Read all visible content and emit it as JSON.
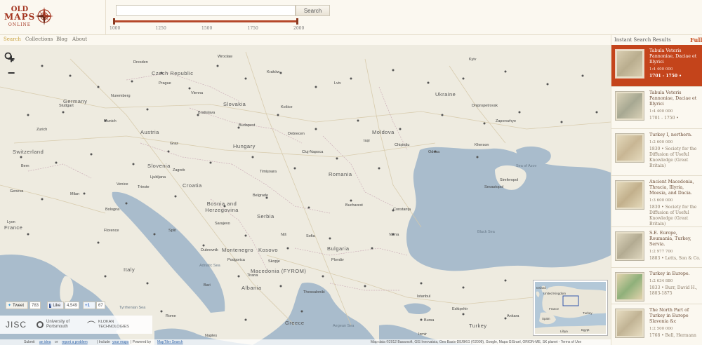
{
  "header": {
    "logo": {
      "line1": "OLD",
      "line2": "MAPS",
      "line3": "ONLINE"
    },
    "search": {
      "placeholder": "",
      "button_label": "Search"
    },
    "timeline": {
      "ticks": [
        "1000",
        "1250",
        "1500",
        "1750",
        "2000"
      ],
      "range_start": 1000,
      "range_end": 2000
    }
  },
  "nav": {
    "items": [
      "Search",
      "Collections",
      "Blog",
      "About"
    ],
    "active": "Search"
  },
  "map": {
    "countries": [
      "Czech Republic",
      "Slovakia",
      "Ukraine",
      "Moldova",
      "Austria",
      "Hungary",
      "Slovenia",
      "Croatia",
      "Romania",
      "Bosnia and Herzegovina",
      "Serbia",
      "Montenegro",
      "Kosovo",
      "Bulgaria",
      "Macedonia (FYROM)",
      "Albania",
      "Greece",
      "Turkey",
      "Italy",
      "Switzerland",
      "France",
      "Germany"
    ],
    "seas": [
      "Sea of Azov",
      "Black Sea",
      "Adriatic Sea",
      "Tyrrhenian Sea",
      "Aegean Sea"
    ],
    "cities": [
      "Prague",
      "Vienna",
      "Bratislava",
      "Budapest",
      "Zagreb",
      "Belgrade",
      "Sarajevo",
      "Bucharest",
      "Sofia",
      "Skopje",
      "Tirana",
      "Chișinău",
      "Odesa",
      "Kyiv",
      "Rome",
      "Naples",
      "Milan",
      "Munich",
      "Zurich",
      "Bern",
      "Geneva",
      "Lyon",
      "Stuttgart",
      "Nuremberg",
      "Dresden",
      "Wrocław",
      "Kraków",
      "Lviv",
      "Cluj-Napoca",
      "Timișoara",
      "Iași",
      "Constanța",
      "Varna",
      "Plovdiv",
      "Thessaloniki",
      "Istanbul",
      "Bursa",
      "Eskișehir",
      "Ankara",
      "Dnipropetrovsk",
      "Zaporozhye",
      "Kherson",
      "Simferopol",
      "Sevastopol",
      "Split",
      "Dubrovnik",
      "Bologna",
      "Florence",
      "Venice",
      "Trieste",
      "Graz",
      "Ljubljana",
      "Bari",
      "Izmir",
      "Košice",
      "Debrecen",
      "Niš",
      "Podgorica"
    ],
    "zoom_in": "+",
    "zoom_out": "−",
    "social": {
      "tweet_label": "Tweet",
      "tweet_count": "783",
      "like_label": "Like",
      "like_count": "4,549",
      "plus_label": "+1",
      "plus_count": "67"
    },
    "partners": [
      "JISC",
      "University of Portsmouth",
      "KLOKAN TECHNOLOGIES"
    ],
    "bottom": {
      "left": "Submit",
      "link1": "an idea",
      "or": "or",
      "link2": "report a problem",
      "include": "| Include",
      "link3": "your maps",
      "powered": "| Powered by",
      "link4": "MapTiler Search",
      "attribution": "Map data ©2012 Basarsoft, GIS Innovatsia, Geo Basis-DE/BKG (©2009), Google, Mapa GISrael, ORION-ME, SK planet - Terms of Use"
    },
    "minimap_labels": [
      "Ireland",
      "United Kingdom",
      "France",
      "Spain",
      "Turkey",
      "Egypt",
      "Libya"
    ]
  },
  "sidebar": {
    "title": "Instant Search Results",
    "full_link": "Fullte",
    "results": [
      {
        "title": "Tabula Veteris Pannoniae, Daciae et Illyrici",
        "scale": "1:4 400 000",
        "meta": "1701 - 1750 •",
        "selected": true
      },
      {
        "title": "Tabula Veteris Pannoniae, Daciae et Illyrici",
        "scale": "1:4 400 000",
        "meta": "1701 - 1750 •",
        "selected": false
      },
      {
        "title": "Turkey I, northern.",
        "scale": "1:2 600 000",
        "meta": "1830 • Society for the Diffusion of Useful Knowledge (Great Britain)",
        "selected": false
      },
      {
        "title": "Ancient Macedonia, Thracia, Illyria, Moesia, and Dacia.",
        "scale": "1:3 600 000",
        "meta": "1830 • Society for the Diffusion of Useful Knowledge (Great Britain)",
        "selected": false
      },
      {
        "title": "S.E. Europe, Roumania, Turkey, Servia.",
        "scale": "1:2 977 700",
        "meta": "1883 • Letts, Son & Co.",
        "selected": false
      },
      {
        "title": "Turkey in Europe.",
        "scale": "1:2 634 880",
        "meta": "1833 • Burr, David H., 1803-1875",
        "selected": false
      },
      {
        "title": "The North Part of Turkey in Europe Slavonia &c",
        "scale": "1:2 500 000",
        "meta": "1768 • Bell, Hermann",
        "selected": false
      }
    ]
  },
  "colors": {
    "accent": "#c4441b",
    "water": "#a9bccc",
    "land": "#eeebe0",
    "logo": "#a3341f"
  }
}
